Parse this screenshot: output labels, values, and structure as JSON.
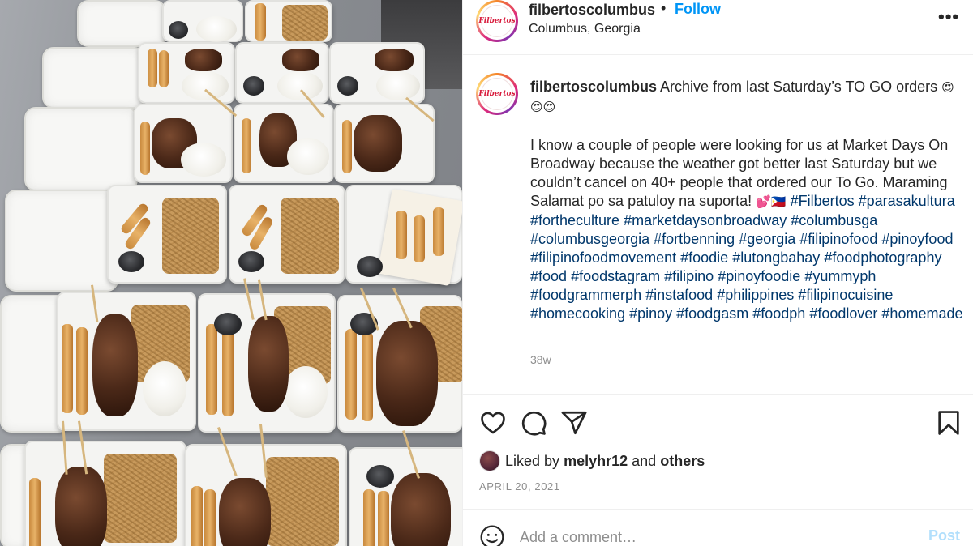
{
  "post": {
    "username": "filbertoscolumbus",
    "separator": "•",
    "follow_label": "Follow",
    "location": "Columbus, Georgia",
    "more_label": "•••",
    "avatar_logo_text": "Filbertos"
  },
  "caption": {
    "username": "filbertoscolumbus",
    "headline": "Archive from last Saturday’s TO GO orders",
    "headline_emoji": "😍",
    "emoji_line": "😍😍",
    "body": "I know a couple of people were looking for us at Market Days On Broadway because the weather got better last Saturday but we couldn’t cancel on 40+ people that ordered our To Go. Maraming Salamat po sa patuloy na suporta!",
    "body_emoji": "💕🇵🇭",
    "hashtags": [
      "#Filbertos",
      "#parasakultura",
      "#fortheculture",
      "#marketdaysonbroadway",
      "#columbusga",
      "#columbusgeorgia",
      "#fortbenning",
      "#georgia",
      "#filipinofood",
      "#pinoyfood",
      "#filipinofoodmovement",
      "#foodie",
      "#lutongbahay",
      "#foodphotography",
      "#food",
      "#foodstagram",
      "#filipino",
      "#pinoyfoodie",
      "#yummyph",
      "#foodgrammerph",
      "#instafood",
      "#philippines",
      "#filipinocuisine",
      "#homecooking",
      "#pinoy",
      "#foodgasm",
      "#foodph",
      "#foodlover",
      "#homemade"
    ],
    "age": "38w"
  },
  "actions": {
    "like_icon": "heart-icon",
    "comment_icon": "comment-icon",
    "share_icon": "share-icon",
    "save_icon": "bookmark-icon"
  },
  "likes": {
    "prefix": "Liked by",
    "user": "melyhr12",
    "conjunction": "and",
    "others": "others"
  },
  "date": "APRIL 20, 2021",
  "comment": {
    "placeholder": "Add a comment…",
    "post_label": "Post",
    "emoji_icon": "smiley-icon"
  },
  "colors": {
    "link_blue": "#0095f6",
    "hashtag": "#00376b",
    "text": "#262626",
    "muted": "#8e8e8e",
    "post_disabled": "#b2dffc"
  }
}
